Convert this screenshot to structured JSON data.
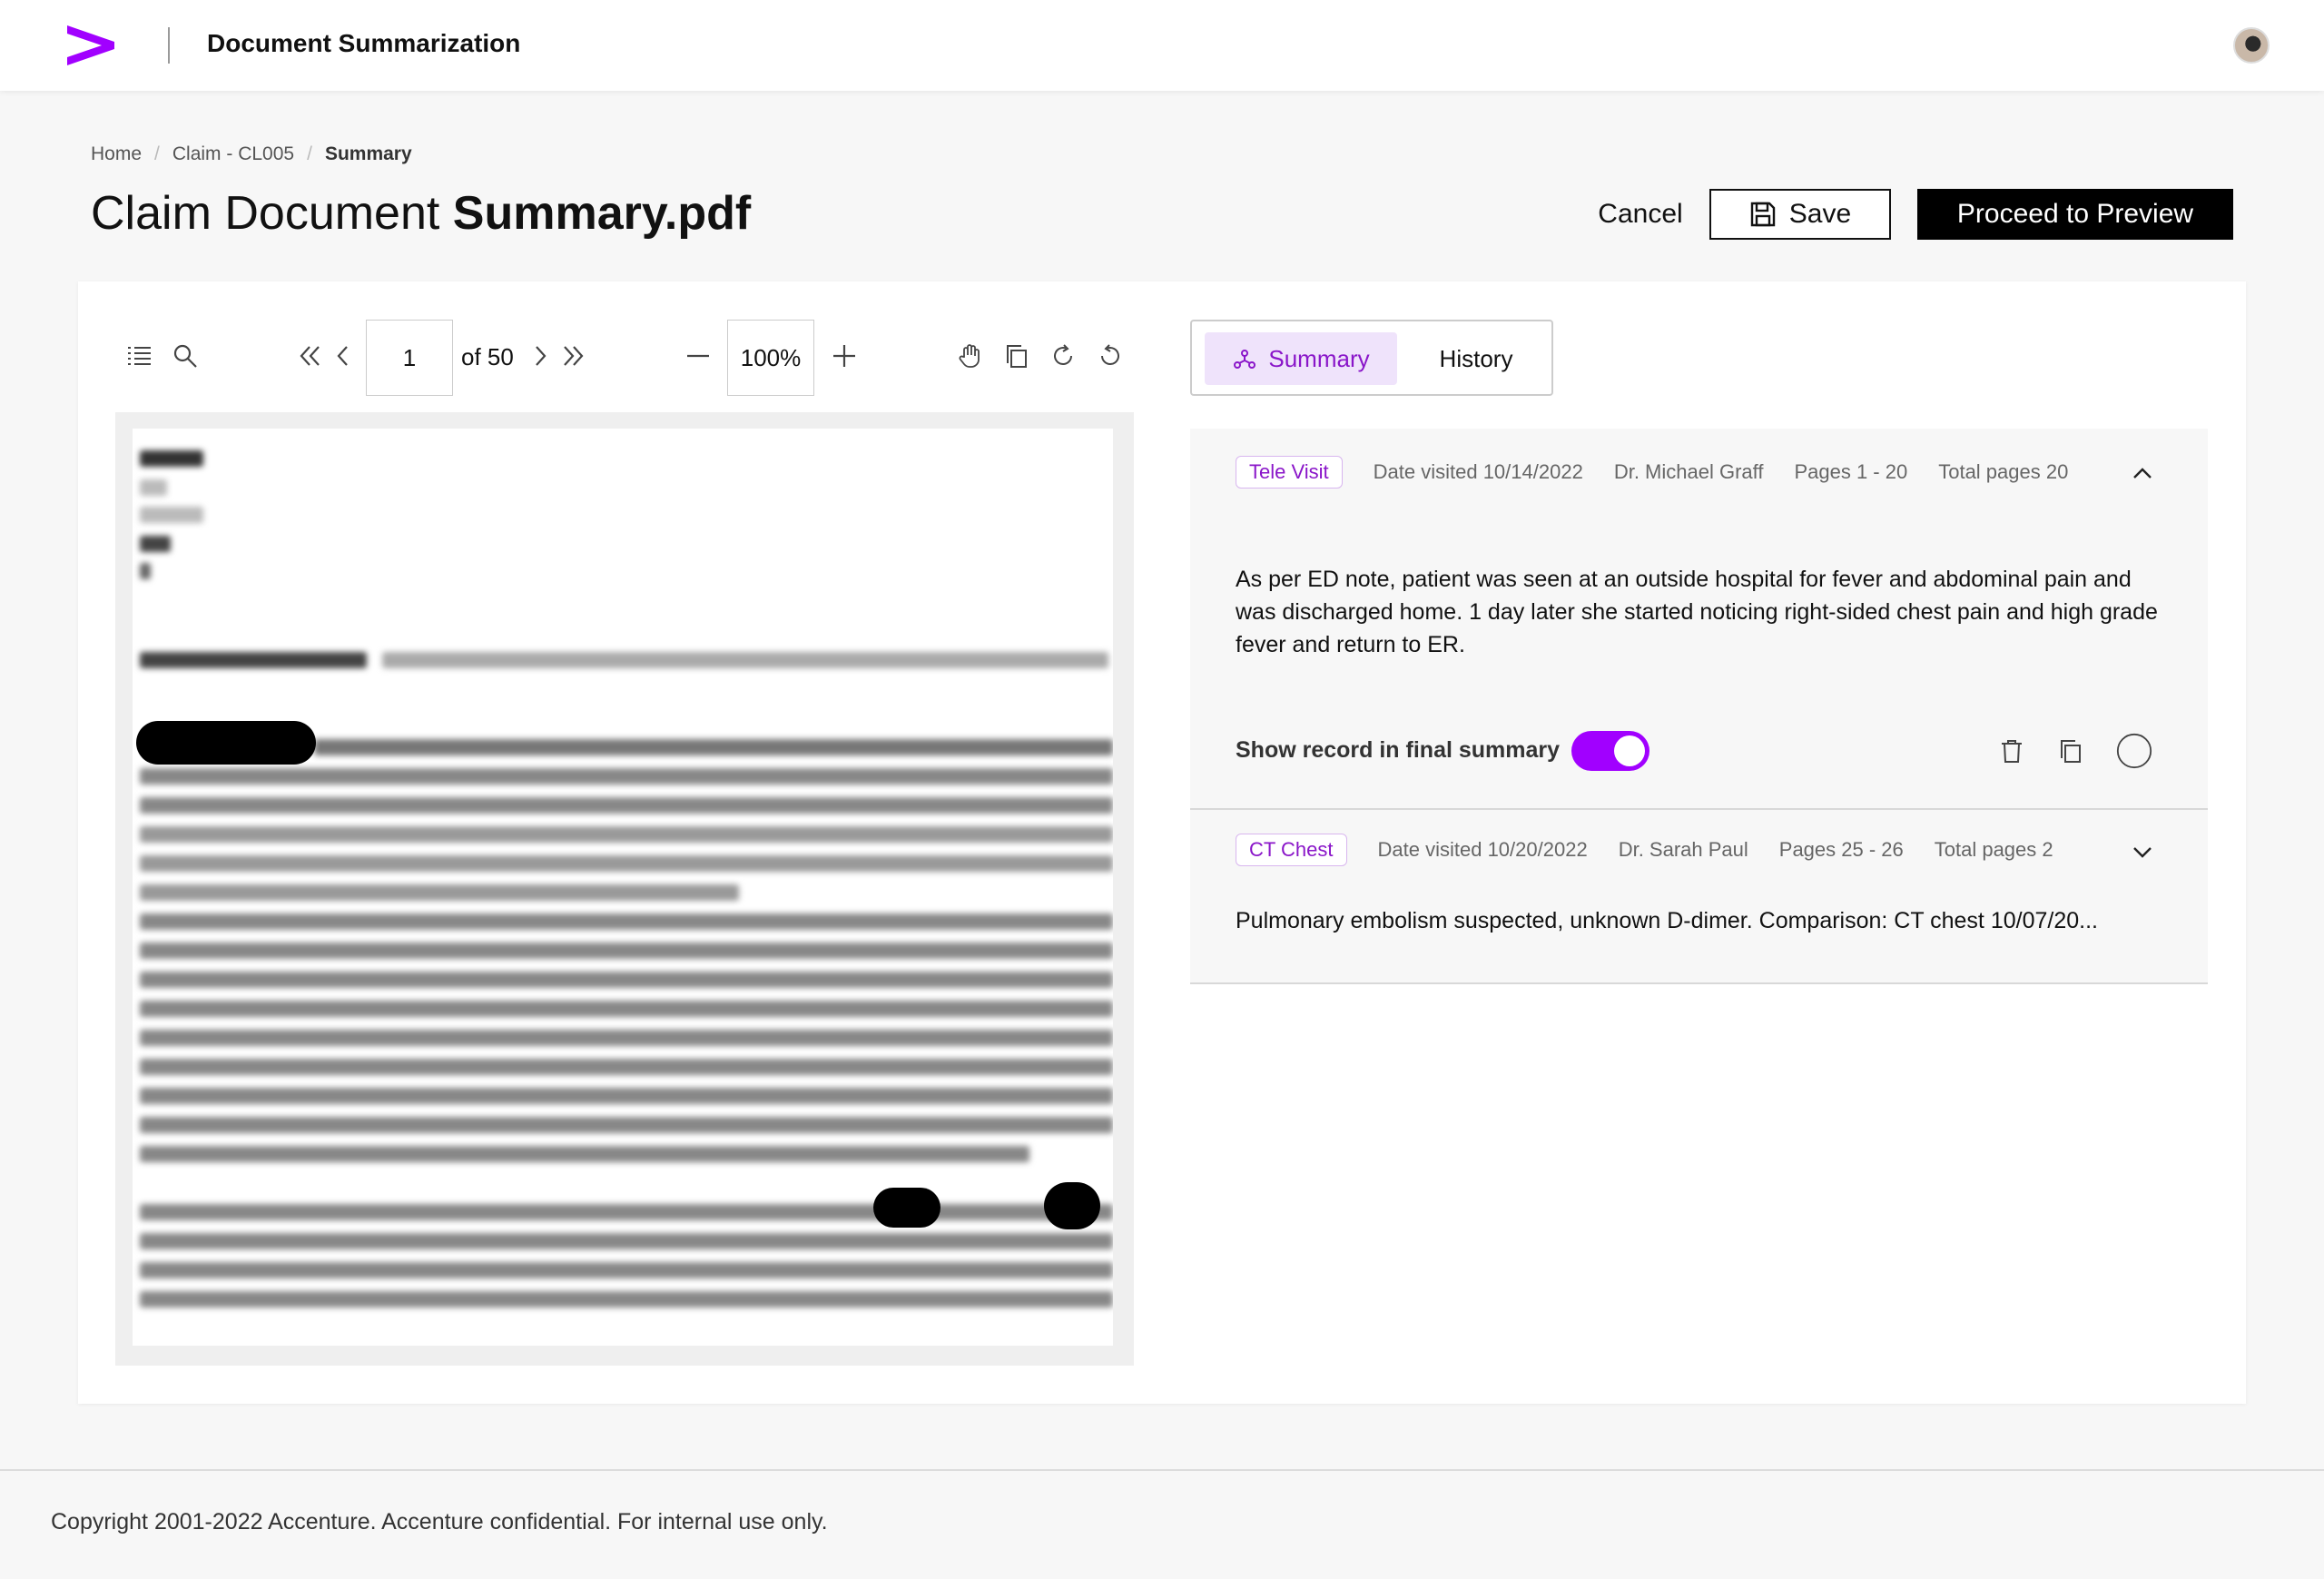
{
  "header": {
    "app_title": "Document Summarization",
    "brand_color": "#A100FF"
  },
  "breadcrumb": {
    "items": [
      "Home",
      "Claim - CL005",
      "Summary"
    ]
  },
  "page": {
    "title_prefix": "Claim Document",
    "title_file": "Summary.pdf"
  },
  "actions": {
    "cancel_label": "Cancel",
    "save_label": "Save",
    "proceed_label": "Proceed to Preview"
  },
  "viewer": {
    "current_page": "1",
    "of_pages": "of 50",
    "zoom": "100%"
  },
  "tabs": {
    "summary_label": "Summary",
    "history_label": "History",
    "active": "Summary"
  },
  "records": [
    {
      "tag": "Tele Visit",
      "date": "Date visited 10/14/2022",
      "doctor": "Dr. Michael Graff",
      "pages": "Pages 1 - 20",
      "total": "Total pages 20",
      "expanded": true,
      "body": "As per ED note, patient was seen at an outside hospital for fever and abdominal pain and was discharged home. 1 day later she started noticing right-sided chest pain and high grade fever and return to ER.",
      "show_label": "Show record in final summary",
      "show_in_summary": true
    },
    {
      "tag": "CT Chest",
      "date": "Date visited 10/20/2022",
      "doctor": "Dr. Sarah Paul",
      "pages": "Pages 25 - 26",
      "total": "Total pages 2",
      "expanded": false,
      "body": "Pulmonary embolism suspected, unknown D-dimer. Comparison: CT chest 10/07/20..."
    }
  ],
  "footer": {
    "copyright": "Copyright 2001-2022 Accenture. Accenture confidential. For internal use only."
  }
}
